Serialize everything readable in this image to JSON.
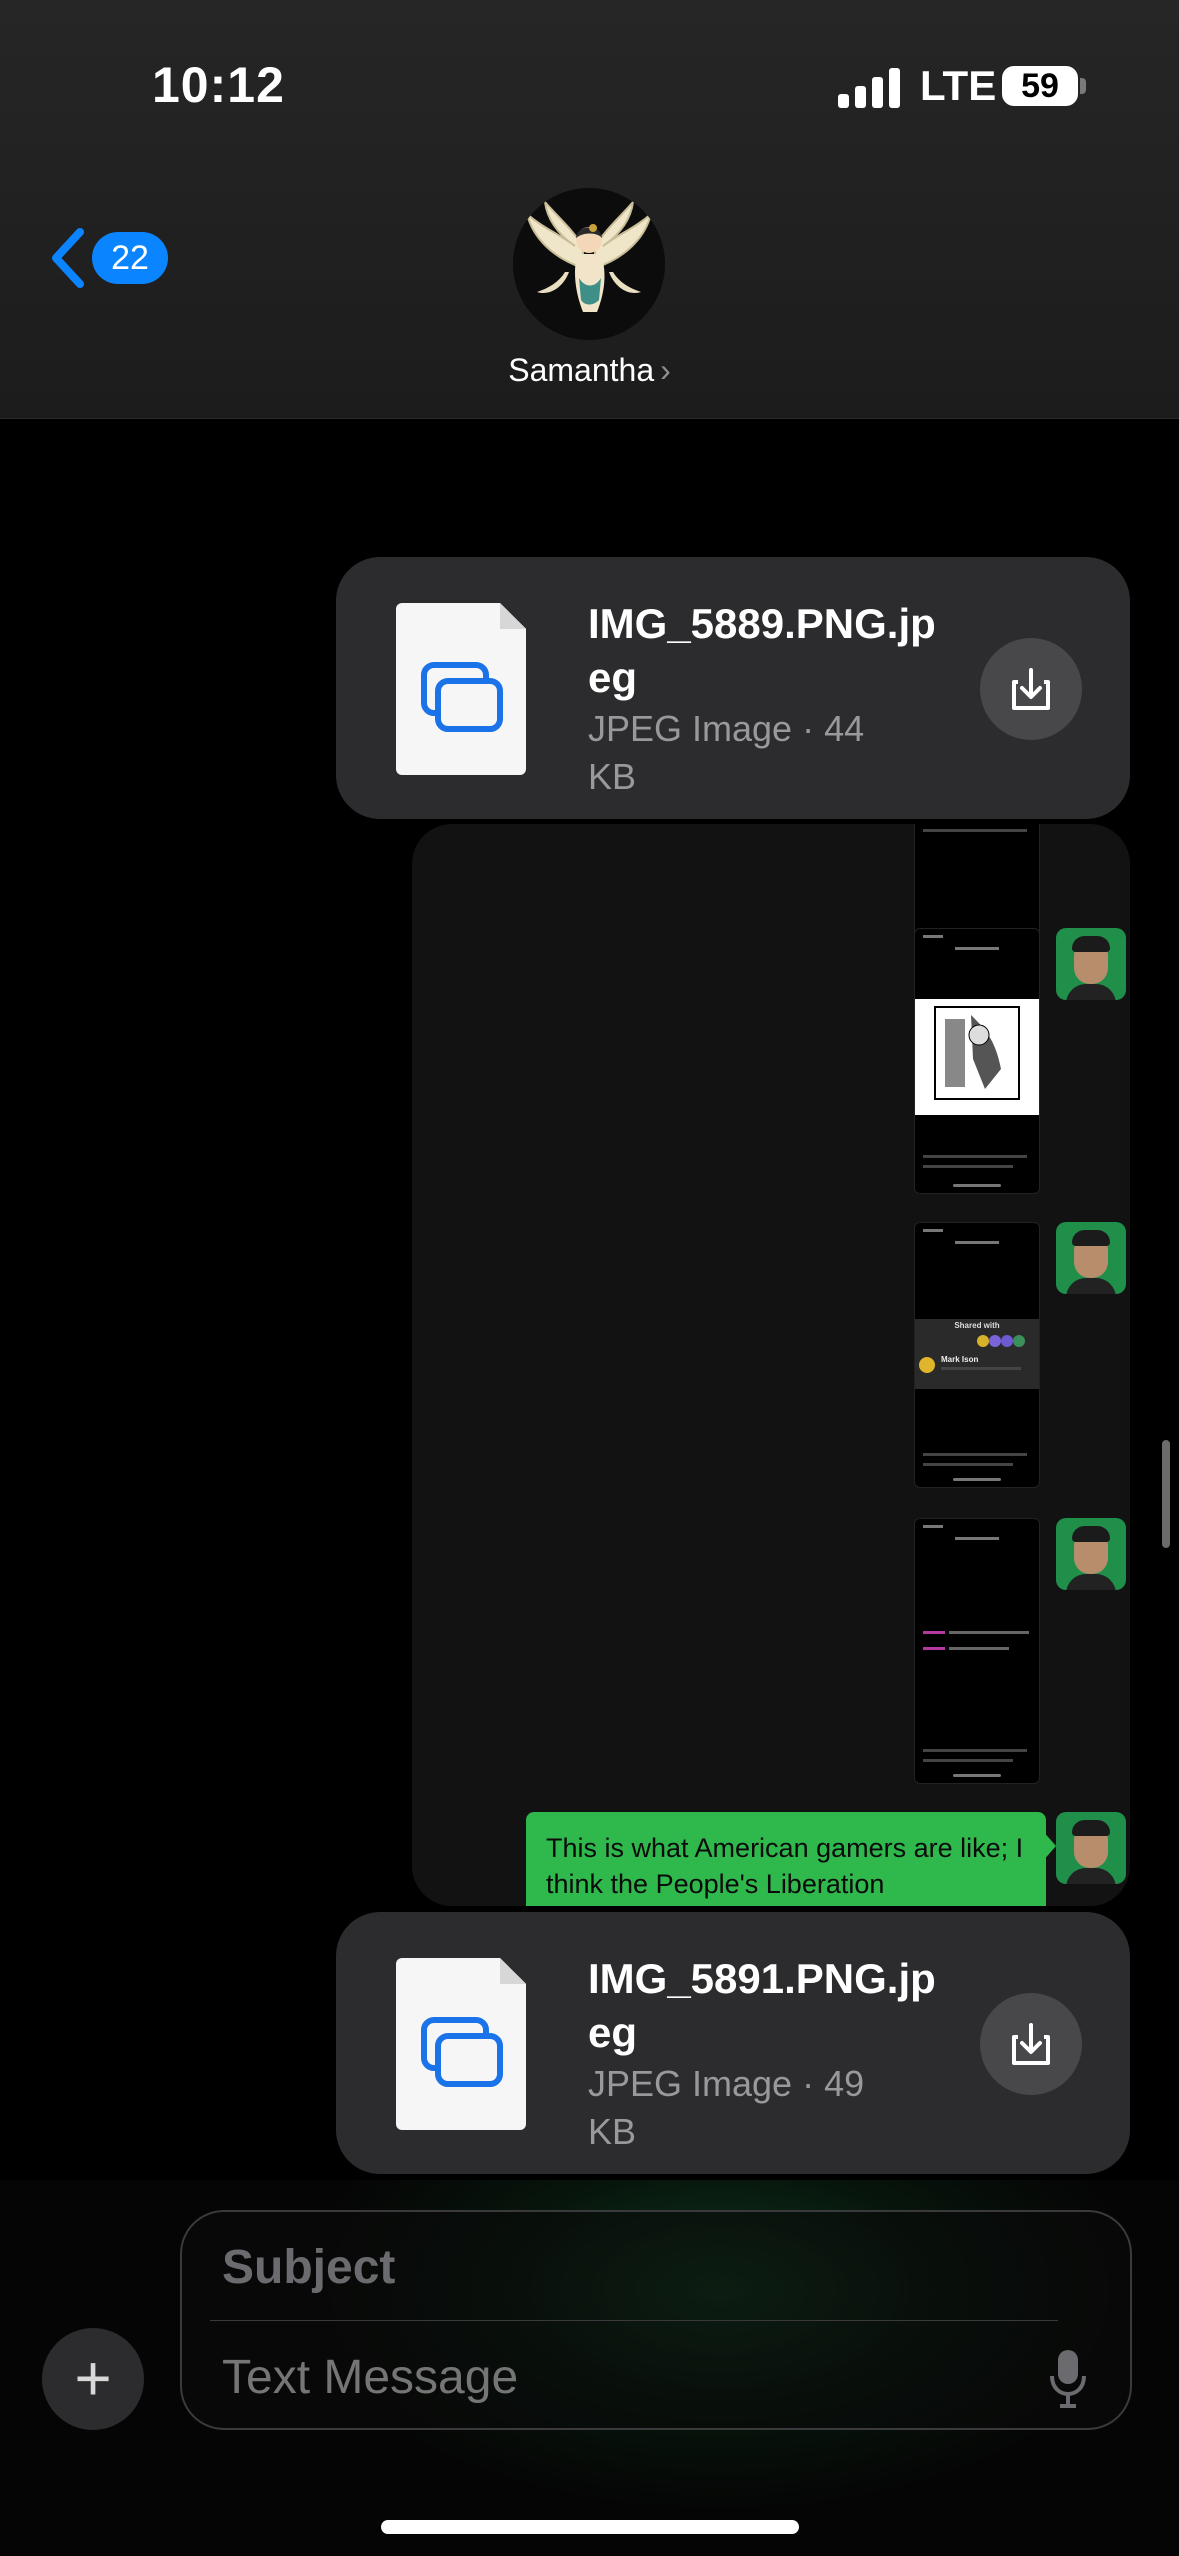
{
  "status_bar": {
    "time": "10:12",
    "network": "LTE",
    "battery": "59"
  },
  "header": {
    "back_count": "22",
    "contact_name": "Samantha",
    "contact_chevron": "›"
  },
  "messages": {
    "file1": {
      "name": "IMG_5889.PNG.jpeg",
      "meta": "JPEG Image · 44 KB"
    },
    "file2": {
      "name": "IMG_5891.PNG.jpeg",
      "meta": "JPEG Image · 49 KB"
    },
    "green_bubble_text": "This is what American gamers are like; I think the People's Liberation",
    "shared_with": "Shared with",
    "mini_name": "Mark Ison",
    "text_message_label": "Text Message"
  },
  "compose": {
    "subject_placeholder": "Subject",
    "message_placeholder": "Text Message",
    "plus_label": "+"
  },
  "colors": {
    "accent": "#0a84ff",
    "bubble_green": "#2fb84b",
    "bubble_gray": "#2c2c2e"
  }
}
